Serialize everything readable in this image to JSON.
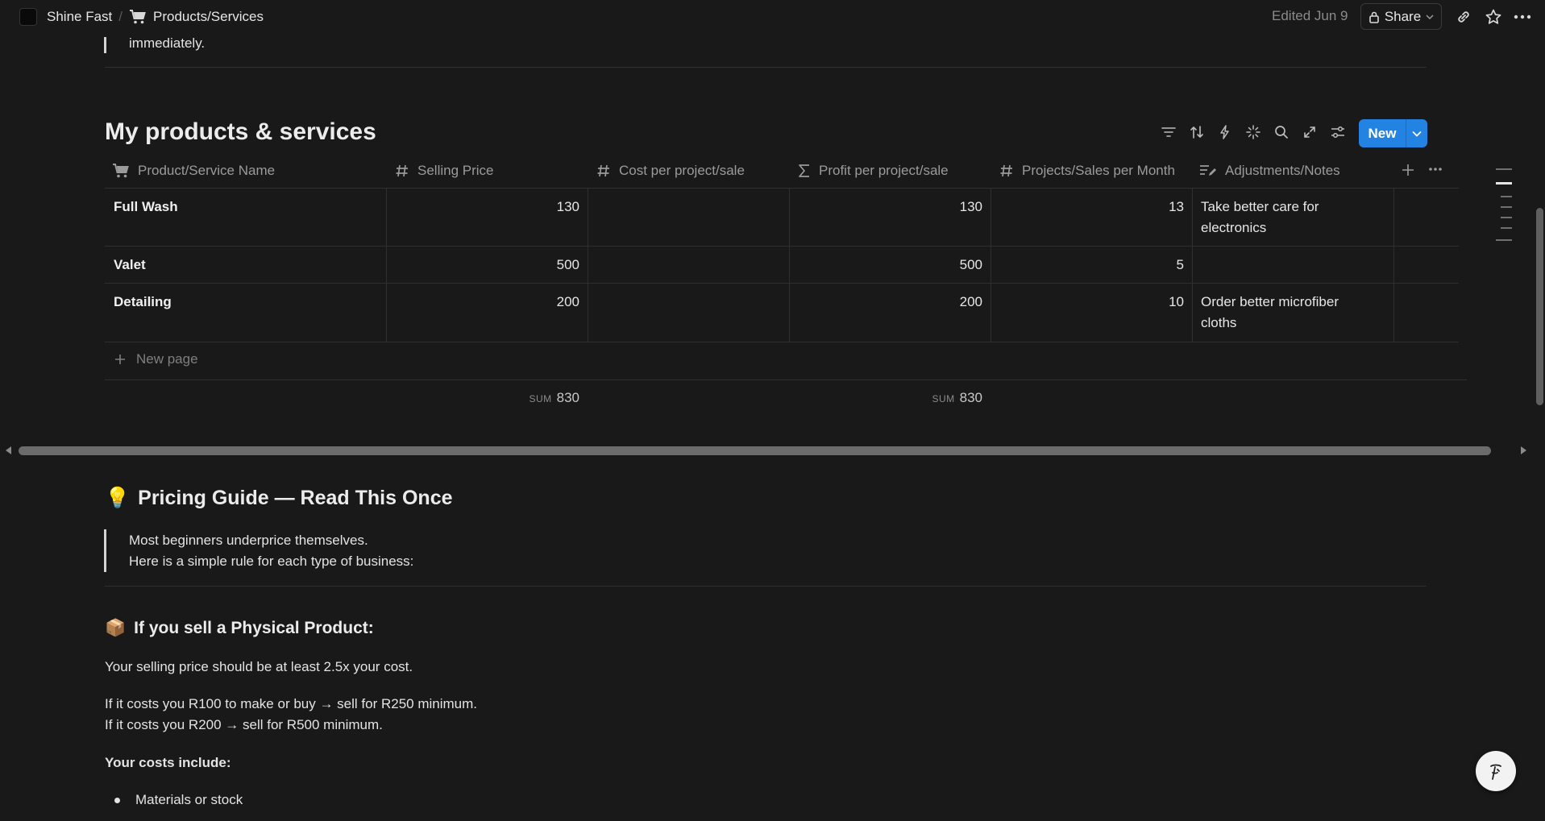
{
  "topbar": {
    "workspace": "Shine Fast",
    "separator": "/",
    "page": "Products/Services",
    "edited": "Edited Jun 9",
    "share": "Share"
  },
  "intro": {
    "quote_tail": "immediately."
  },
  "database": {
    "title": "My products & services",
    "new_label": "New",
    "columns": [
      {
        "label": "Product/Service Name",
        "icon": "cart-icon"
      },
      {
        "label": "Selling Price",
        "icon": "number-icon"
      },
      {
        "label": "Cost per project/sale",
        "icon": "number-icon"
      },
      {
        "label": "Profit per project/sale",
        "icon": "sigma-icon"
      },
      {
        "label": "Projects/Sales per Month",
        "icon": "number-icon"
      },
      {
        "label": "Adjustments/Notes",
        "icon": "edit-text-icon"
      }
    ],
    "rows": [
      {
        "name": "Full Wash",
        "selling": "130",
        "cost": "",
        "profit": "130",
        "per_month": "13",
        "notes": [
          "Take better care for",
          "electronics"
        ]
      },
      {
        "name": "Valet",
        "selling": "500",
        "cost": "",
        "profit": "500",
        "per_month": "5",
        "notes": [
          "",
          ""
        ]
      },
      {
        "name": "Detailing",
        "selling": "200",
        "cost": "",
        "profit": "200",
        "per_month": "10",
        "notes": [
          "Order better microfiber",
          "cloths"
        ]
      }
    ],
    "new_page": "New page",
    "sum_label": "SUM",
    "sum_selling": "830",
    "sum_profit": "830"
  },
  "guide": {
    "emoji": "💡",
    "title": "Pricing Guide — Read This Once",
    "quote_line1": "Most beginners underprice themselves.",
    "quote_line2": "Here is a simple rule for each type of business:"
  },
  "physical": {
    "emoji": "📦",
    "title": "If you sell a Physical Product:",
    "p1": "Your selling price should be at least 2.5x your cost.",
    "p2_line1": "If it costs you R100 to make or buy → sell for R250 minimum.",
    "p2_line2": "If it costs you R200 → sell for R500 minimum.",
    "costs_heading": "Your costs include:",
    "bullet1": "Materials or stock"
  },
  "colors": {
    "background": "#191919",
    "accent": "#2383e2",
    "text": "#e6e6e6",
    "muted": "#9b9b9b"
  }
}
